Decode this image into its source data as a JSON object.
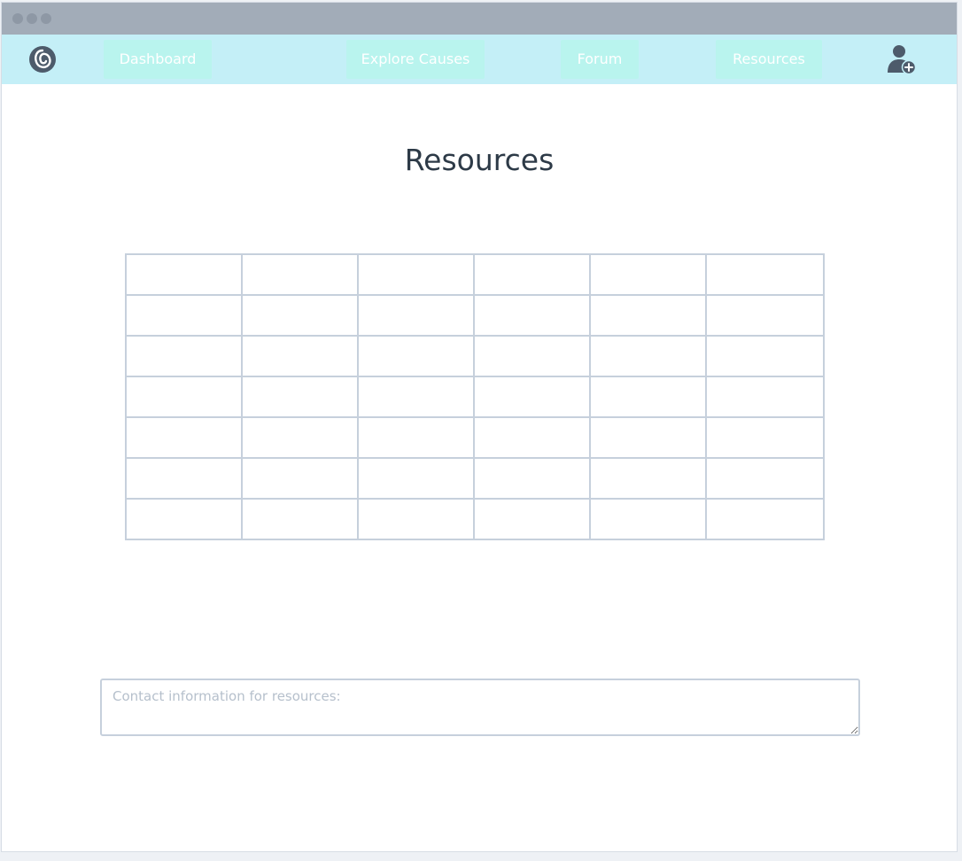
{
  "nav": {
    "items": [
      {
        "label": "Dashboard"
      },
      {
        "label": "Explore Causes"
      },
      {
        "label": "Forum"
      },
      {
        "label": "Resources"
      }
    ]
  },
  "icons": {
    "logo": "swirl-logo-icon",
    "user": "add-user-icon"
  },
  "page": {
    "title": "Resources"
  },
  "resources_table": {
    "rows": 7,
    "columns": 6,
    "cells": [
      [
        "",
        "",
        "",
        "",
        "",
        ""
      ],
      [
        "",
        "",
        "",
        "",
        "",
        ""
      ],
      [
        "",
        "",
        "",
        "",
        "",
        ""
      ],
      [
        "",
        "",
        "",
        "",
        "",
        ""
      ],
      [
        "",
        "",
        "",
        "",
        "",
        ""
      ],
      [
        "",
        "",
        "",
        "",
        "",
        ""
      ],
      [
        "",
        "",
        "",
        "",
        "",
        ""
      ]
    ]
  },
  "contact": {
    "value": "",
    "placeholder": "Contact information for resources:"
  },
  "colors": {
    "titlebar": "#a2acb8",
    "navbar": "#c4eff7",
    "nav_button": "#b9f4ee",
    "border": "#c6d0dc",
    "title_text": "#2d3a47"
  }
}
